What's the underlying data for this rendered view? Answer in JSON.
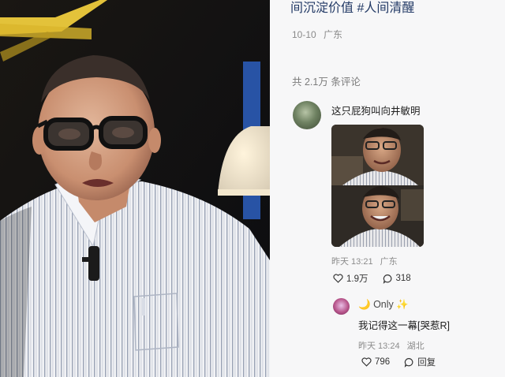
{
  "post": {
    "title": "间沉淀价值 #人间清醒",
    "date": "10-10",
    "location": "广东"
  },
  "comments_header": {
    "count_text": "共 2.1万 条评论"
  },
  "comments": [
    {
      "text": "这只屁狗叫向井敏明",
      "time": "昨天 13:21",
      "location": "广东",
      "likes": "1.9万",
      "replies": "318",
      "image_desc_icon": "meme-image"
    },
    {
      "username": "Only",
      "username_prefix_emoji": "🌙",
      "username_suffix_emoji": "✨",
      "text": "我记得这一幕[哭惹R]",
      "time": "昨天 13:24",
      "location": "湖北",
      "likes": "796",
      "reply_label": "回复"
    }
  ],
  "icons": {
    "like": "heart-icon",
    "reply": "comment-bubble-icon"
  },
  "colors": {
    "title": "#233a66",
    "meta": "#8a8a8a",
    "panel_bg": "#f7f7f8"
  }
}
